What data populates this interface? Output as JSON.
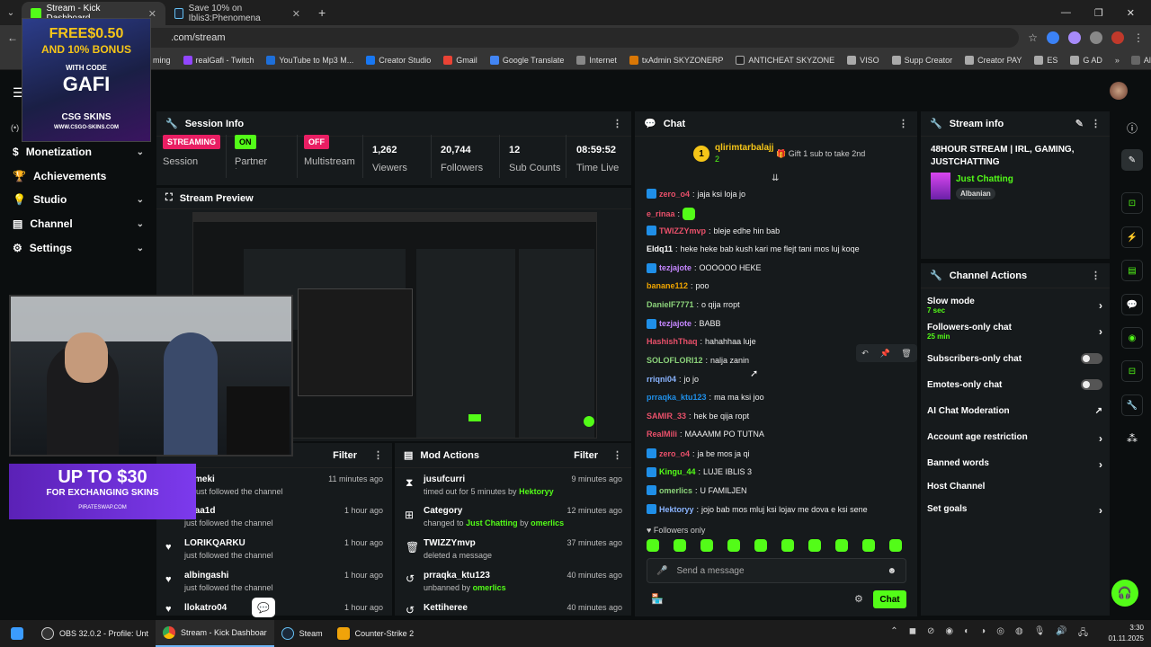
{
  "browser": {
    "tabs": [
      {
        "label": "Stream - Kick Dashboard",
        "active": true
      },
      {
        "label": "Save 10% on Iblis3:Phenomena",
        "active": false
      }
    ],
    "url": ".com/stream",
    "bookmarks": [
      "ming",
      "realGafi - Twitch",
      "YouTube to Mp3 M...",
      "Creator Studio",
      "Gmail",
      "Google Translate",
      "Internet",
      "txAdmin SKYZONERP",
      "ANTICHEAT SKYZONE",
      "VISO",
      "Supp Creator",
      "Creator PAY",
      "ES",
      "G AD"
    ],
    "all_bookmarks": "All Bookmarks"
  },
  "nav": {
    "monetization": "Monetization",
    "achievements": "Achievements",
    "studio": "Studio",
    "channel": "Channel",
    "settings": "Settings"
  },
  "session": {
    "title": "Session Info",
    "streaming_badge": "STREAMING",
    "session_label": "Session",
    "partner_badge": "ON",
    "partner_label": "Partner Income",
    "multistream_badge": "OFF",
    "multistream_label": "Multistream",
    "viewers_value": "1,262",
    "viewers_label": "Viewers",
    "followers_value": "20,744",
    "followers_label": "Followers",
    "subs_value": "12",
    "subs_label": "Sub Counts",
    "time_value": "08:59:52",
    "time_label": "Time Live"
  },
  "preview": {
    "title": "Stream Preview"
  },
  "activity": {
    "filter": "Filter",
    "items": [
      {
        "name": "meki",
        "action": "just followed the channel",
        "time": "11 minutes ago"
      },
      {
        "name": "oyaa1d",
        "action": "just followed the channel",
        "time": "1 hour ago"
      },
      {
        "name": "LORIKQARKU",
        "action": "just followed the channel",
        "time": "1 hour ago"
      },
      {
        "name": "albingashi",
        "action": "just followed the channel",
        "time": "1 hour ago"
      },
      {
        "name": "llokatro04",
        "action": "",
        "time": "1 hour ago"
      }
    ]
  },
  "mod_actions": {
    "title": "Mod Actions",
    "filter": "Filter",
    "items": [
      {
        "name": "jusufcurri",
        "action": "timed out for 5 minutes by",
        "by": "Hektoryy",
        "time": "9 minutes ago"
      },
      {
        "name": "Category",
        "action": "changed to",
        "target": "Just Chatting",
        "by_word": "by",
        "by": "omerlics",
        "time": "12 minutes ago"
      },
      {
        "name": "TWIZZYmvp",
        "action": "deleted a message",
        "time": "37 minutes ago"
      },
      {
        "name": "prraqka_ktu123",
        "action": "unbanned by",
        "by": "omerlics",
        "time": "40 minutes ago"
      },
      {
        "name": "Kettiheree",
        "action": "",
        "time": "40 minutes ago"
      }
    ]
  },
  "chat": {
    "title": "Chat",
    "top_gifter": "qlirimtarbalajj",
    "top_gifter_count": "2",
    "gift_prompt": "Gift 1 sub to take 2nd",
    "messages": [
      {
        "user": "zero_o4",
        "text": "jaja ksi loja jo",
        "color": "#e9506a",
        "badge": true
      },
      {
        "user": "e_rinaa",
        "text": "",
        "color": "#e9506a",
        "badge": false
      },
      {
        "user": "TWIZZYmvp",
        "text": "bleje edhe hin bab",
        "color": "#e9506a",
        "badge": true
      },
      {
        "user": "Eldq11",
        "text": "heke heke bab kush kari me flejt tani mos luj koqe",
        "color": "#ffffff",
        "badge": false
      },
      {
        "user": "tezjajote",
        "text": "OOOOOO HEKE",
        "color": "#c586ff",
        "badge": true
      },
      {
        "user": "banane112",
        "text": "poo",
        "color": "#f0a500",
        "badge": false
      },
      {
        "user": "DanielF7771",
        "text": "o qija rropt",
        "color": "#8bd27a",
        "badge": false
      },
      {
        "user": "tezjajote",
        "text": "BABB",
        "color": "#c586ff",
        "badge": true
      },
      {
        "user": "HashishThaq",
        "text": "hahahhaa luje",
        "color": "#e9506a",
        "badge": false
      },
      {
        "user": "SOLOFLORI12",
        "text": "nalja zanin",
        "color": "#8bd27a",
        "badge": false
      },
      {
        "user": "rriqni04",
        "text": "jo jo",
        "color": "#8ab4ff",
        "badge": false
      },
      {
        "user": "prraqka_ktu123",
        "text": "ma ma ksi joo",
        "color": "#1f8fe8",
        "badge": false
      },
      {
        "user": "SAMIR_33",
        "text": "hek be qija ropt",
        "color": "#e9506a",
        "badge": false
      },
      {
        "user": "RealMili",
        "text": "MAAAMM PO TUTNA",
        "color": "#e9506a",
        "badge": false
      },
      {
        "user": "zero_o4",
        "text": "ja be mos ja qi",
        "color": "#e9506a",
        "badge": true
      },
      {
        "user": "Kingu_44",
        "text": "LUJE IBLIS 3",
        "color": "#53fc18",
        "badge": true
      },
      {
        "user": "omerlics",
        "text": "U FAMILJEN",
        "color": "#8bd27a",
        "badge": true
      },
      {
        "user": "Hektoryy",
        "text": "jojo bab mos mluj ksi lojav me dova e ksi sene",
        "color": "#8ab4ff",
        "badge": true
      }
    ],
    "followers_only": "Followers only",
    "send_placeholder": "Send a message",
    "send_button": "Chat"
  },
  "stream_info": {
    "title": "Stream info",
    "stream_title": "48HOUR STREAM | IRL, GAMING, JUSTCHATTING",
    "category": "Just Chatting",
    "language": "Albanian"
  },
  "channel_actions": {
    "title": "Channel Actions",
    "slow_mode": "Slow mode",
    "slow_mode_value": "7 sec",
    "followers_only": "Followers-only chat",
    "followers_only_value": "25 min",
    "subscribers_only": "Subscribers-only chat",
    "emotes_only": "Emotes-only chat",
    "ai_moderation": "AI Chat Moderation",
    "account_age": "Account age restriction",
    "banned_words": "Banned words",
    "host_channel": "Host Channel",
    "set_goals": "Set goals"
  },
  "overlays": {
    "ad1_line1": "FREE$0.50",
    "ad1_line2": "AND 10% BONUS",
    "ad1_line3": "WITH CODE",
    "ad1_code": "GAFI",
    "ad1_brand": "CSG SKINS",
    "ad1_site": "WWW.CSGO-SKINS.COM",
    "ad2_line1": "UP TO $30",
    "ad2_line2": "FOR EXCHANGING SKINS",
    "ad2_site": "PIRATESWAP.COM"
  },
  "taskbar": {
    "apps": [
      {
        "label": "OBS 32.0.2 - Profile: Unt",
        "active": false
      },
      {
        "label": "Stream - Kick Dashboar",
        "active": true
      },
      {
        "label": "Steam",
        "active": false
      },
      {
        "label": "Counter-Strike 2",
        "active": false
      }
    ],
    "time": "3:30",
    "date": "01.11.2025"
  },
  "colors": {
    "kick_green": "#53fc18",
    "streaming_red": "#e91e63",
    "panel": "#161a1c",
    "bg": "#0b0e0f"
  }
}
